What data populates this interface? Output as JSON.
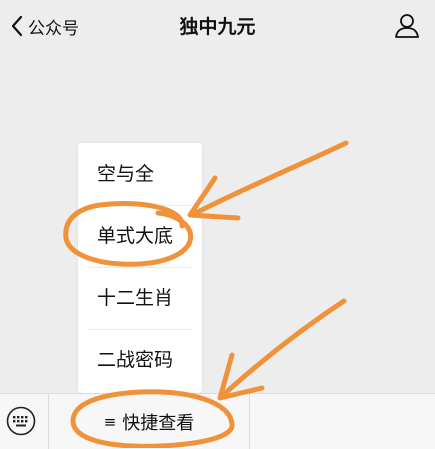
{
  "navbar": {
    "back_icon": "chevron-left-icon",
    "back_label": "公众号",
    "title": "独中九元",
    "profile_icon": "person-icon"
  },
  "menu": {
    "items": [
      {
        "label": "空与全"
      },
      {
        "label": "单式大底"
      },
      {
        "label": "十二生肖"
      },
      {
        "label": "二战密码"
      }
    ]
  },
  "bottombar": {
    "keyboard_icon": "keyboard-icon",
    "menu_glyph": "≡",
    "quick_view_label": "快捷查看"
  },
  "annotation_color": "#f0923a"
}
